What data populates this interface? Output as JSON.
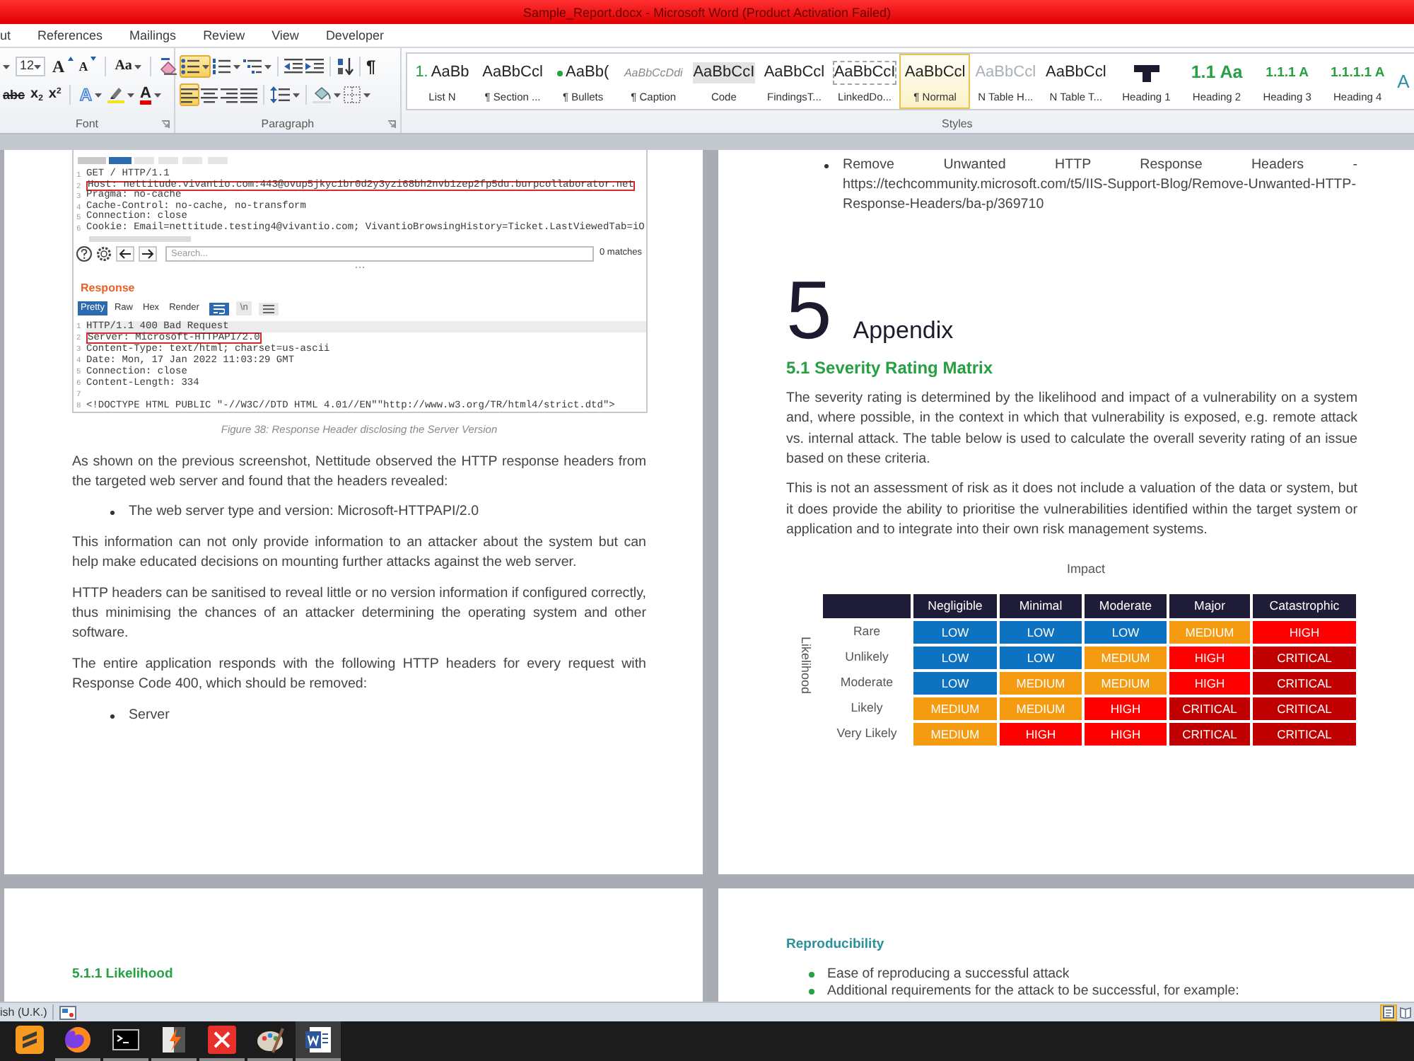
{
  "window": {
    "title": "Sample_Report.docx - Microsoft Word (Product Activation Failed)"
  },
  "ribbon_tabs": [
    {
      "label": "ut",
      "selected": false
    },
    {
      "label": "References",
      "selected": false
    },
    {
      "label": "Mailings",
      "selected": false
    },
    {
      "label": "Review",
      "selected": false
    },
    {
      "label": "View",
      "selected": false
    },
    {
      "label": "Developer",
      "selected": false
    }
  ],
  "font_group": {
    "label": "Font",
    "rows": [
      [
        [
          {
            "kind": "font-name",
            "dropdown": true
          },
          {
            "kind": "size",
            "value": "12",
            "dropdown": true
          },
          {
            "kind": "grow",
            "text": "A",
            "dropdown": false
          },
          {
            "kind": "shrink",
            "text": "A",
            "dropdown": false
          }
        ],
        [
          {
            "kind": "case",
            "text": "Aa",
            "dropdown": true
          }
        ],
        [
          {
            "kind": "clear",
            "dropdown": false
          }
        ]
      ],
      [
        [
          {
            "kind": "strike",
            "text": "abc",
            "dropdown": false
          },
          {
            "kind": "sub",
            "text": "x$_{2}$",
            "dropdown": false
          },
          {
            "kind": "sup",
            "text": "x$^{2}$",
            "dropdown": false
          }
        ],
        [
          {
            "kind": "effects",
            "text": "A",
            "dropdown": true
          },
          {
            "kind": "highlight",
            "dropdown": true
          },
          {
            "kind": "color",
            "text": "A",
            "dropdown": true
          }
        ]
      ]
    ]
  },
  "paragraph_group": {
    "label": "Paragraph",
    "rows": [
      [
        [
          {
            "kind": "bullets",
            "selected": true,
            "dropdown": true
          },
          {
            "kind": "numbering",
            "selected": false,
            "dropdown": true
          },
          {
            "kind": "multilevel",
            "selected": false,
            "dropdown": true
          }
        ],
        [
          {
            "kind": "outdent",
            "selected": false,
            "dropdown": false
          },
          {
            "kind": "indent",
            "selected": false,
            "dropdown": false
          }
        ],
        [
          {
            "kind": "sort",
            "selected": false,
            "dropdown": false
          }
        ],
        [
          {
            "kind": "marks",
            "text": "¶",
            "selected": false,
            "dropdown": false
          }
        ]
      ],
      [
        [
          {
            "kind": "left",
            "selected": true,
            "dropdown": false
          },
          {
            "kind": "center",
            "selected": false,
            "dropdown": false
          },
          {
            "kind": "right",
            "selected": false,
            "dropdown": false
          },
          {
            "kind": "justify",
            "selected": false,
            "dropdown": false
          }
        ],
        [
          {
            "kind": "spacing",
            "selected": false,
            "dropdown": true
          }
        ],
        [
          {
            "kind": "shading",
            "selected": false,
            "dropdown": true
          },
          {
            "kind": "borders",
            "selected": false,
            "dropdown": true
          }
        ]
      ]
    ]
  },
  "styles_group": {
    "label": "Styles",
    "items": [
      {
        "kind": "list",
        "prefix": "1.",
        "preview": "AaBb",
        "label": "List N",
        "selected": false
      },
      {
        "kind": "plain",
        "preview": "AaBbCcl",
        "label": "¶ Section ...",
        "selected": false
      },
      {
        "kind": "bullet",
        "preview": "AaBb(",
        "label": "¶ Bullets",
        "selected": false
      },
      {
        "kind": "caption",
        "preview": "AaBbCcDdi",
        "label": "¶ Caption",
        "selected": false
      },
      {
        "kind": "code",
        "preview": "AaBbCcI",
        "label": "Code",
        "selected": false
      },
      {
        "kind": "plain",
        "preview": "AaBbCcl",
        "label": "FindingsT...",
        "selected": false
      },
      {
        "kind": "linked",
        "preview": "AaBbCcI",
        "label": "LinkedDo...",
        "selected": false
      },
      {
        "kind": "plain",
        "preview": "AaBbCcl",
        "label": "¶ Normal",
        "selected": true
      },
      {
        "kind": "faint",
        "preview": "AaBbCcl",
        "label": "N Table H...",
        "selected": false
      },
      {
        "kind": "plain",
        "preview": "AaBbCcl",
        "label": "N Table T...",
        "selected": false
      },
      {
        "kind": "graphic",
        "label": "Heading 1",
        "selected": false
      },
      {
        "kind": "heading",
        "preview": "1.1 Aa",
        "label": "Heading 2",
        "selected": false
      },
      {
        "kind": "heading-small",
        "preview": "1.1.1 A",
        "label": "Heading 3",
        "selected": false
      },
      {
        "kind": "heading-small",
        "preview": "1.1.1.1 A",
        "label": "Heading 4",
        "selected": false
      },
      {
        "kind": "heading-cut",
        "preview": "A",
        "selected": false
      }
    ]
  },
  "left_page": {
    "screenshot": {
      "request_lines": [
        {
          "number": "1",
          "text": "GET / HTTP/1.1",
          "boxed": false,
          "current": false
        },
        {
          "number": "2",
          "text": "Host: nettitude.vivantio.com:443@ovup5jkyc1br0d2y3yzi68bh2nvb1zep2fp5du.burpcollaborator.net",
          "boxed": true,
          "current": false
        },
        {
          "number": "3",
          "text": "Pragma: no-cache",
          "boxed": false,
          "current": false
        },
        {
          "number": "4",
          "text": "Cache-Control: no-cache, no-transform",
          "boxed": false,
          "current": false
        },
        {
          "number": "5",
          "text": "Connection: close",
          "boxed": false,
          "current": false
        },
        {
          "number": "6",
          "text": "Cookie: Email=nettitude.testing4@vivantio.com; VivantioBrowsingHistory=Ticket.LastViewedTab=iO",
          "boxed": false,
          "current": false
        }
      ],
      "search": {
        "placeholder": "Search...",
        "matches": "0 matches"
      },
      "response_title": "Response",
      "response_tabs": [
        {
          "label": "Pretty",
          "selected": true
        },
        {
          "label": "Raw",
          "selected": false
        },
        {
          "label": "Hex",
          "selected": false
        },
        {
          "label": "Render",
          "selected": false
        }
      ],
      "response_tools": [
        {
          "kind": "wrap",
          "selected": true
        },
        {
          "kind": "newline",
          "text": "\\n",
          "selected": false
        },
        {
          "kind": "menu",
          "selected": false
        }
      ],
      "response_lines": [
        {
          "number": "1",
          "text": "HTTP/1.1 400 Bad Request",
          "boxed": false,
          "current": true
        },
        {
          "number": "2",
          "text": "Server: Microsoft-HTTPAPI/2.0",
          "boxed": true,
          "current": false
        },
        {
          "number": "3",
          "text": "Content-Type: text/html; charset=us-ascii",
          "boxed": false,
          "current": false
        },
        {
          "number": "4",
          "text": "Date: Mon, 17 Jan 2022 11:03:29 GMT",
          "boxed": false,
          "current": false
        },
        {
          "number": "5",
          "text": "Connection: close",
          "boxed": false,
          "current": false
        },
        {
          "number": "6",
          "text": "Content-Length: 334",
          "boxed": false,
          "current": false
        },
        {
          "number": "7",
          "boxed": false,
          "current": false
        },
        {
          "number": "8",
          "text": "<!DOCTYPE HTML PUBLIC \"-//W3C//DTD HTML 4.01//EN\"\"http://www.w3.org/TR/html4/strict.dtd\">",
          "boxed": false,
          "current": false
        }
      ]
    },
    "caption": "Figure 38: Response Header disclosing the Server Version",
    "blocks": [
      {
        "kind": "paragraph",
        "text": "As shown on the previous screenshot, Nettitude observed the HTTP response headers from the targeted web server and found that the headers revealed:"
      },
      {
        "kind": "bullet",
        "text": "The web server type and version: Microsoft-HTTPAPI/2.0"
      },
      {
        "kind": "paragraph",
        "text": "This information can not only provide information to an attacker about the system but can help make educated decisions on mounting further attacks against the web server."
      },
      {
        "kind": "paragraph",
        "text": "HTTP headers can be sanitised to reveal little or no version information if configured correctly, thus minimising the chances of an attacker determining the operating system and other software."
      },
      {
        "kind": "paragraph",
        "text": "The entire application responds with the following HTTP headers for every request with Response Code 400, which should be removed:"
      },
      {
        "kind": "bullet",
        "text": "Server"
      }
    ]
  },
  "right_page": {
    "bullets": [
      "Remove Unwanted HTTP Response Headers - https://techcommunity.microsoft.com/t5/IIS-Support-Blog/Remove-Unwanted-HTTP-Response-Headers/ba-p/369710"
    ],
    "chapter": {
      "number": "5",
      "title": "Appendix"
    },
    "section_title": "5.1 Severity Rating Matrix",
    "paragraphs": [
      "The severity rating is determined by the likelihood and impact of a vulnerability on a system and, where possible, in the context in which that vulnerability is exposed, e.g. remote attack vs. internal attack. The table below is used to calculate the overall severity rating of an issue based on these criteria.",
      "This is not an assessment of risk as it does not include a valuation of the data or system, but it does provide the ability to prioritise the vulnerabilities identified within the target system or application and to integrate into their own risk management systems."
    ],
    "matrix": {
      "x_axis": "Impact",
      "y_axis": "Likelihood",
      "columns": [
        "Negligible",
        "Minimal",
        "Moderate",
        "Major",
        "Catastrophic"
      ],
      "rows": [
        {
          "label": "Rare",
          "cells": [
            {
              "text": "LOW",
              "color": "#0d72c0"
            },
            {
              "text": "LOW",
              "color": "#0d72c0"
            },
            {
              "text": "LOW",
              "color": "#0d72c0"
            },
            {
              "text": "MEDIUM",
              "color": "#f59b12"
            },
            {
              "text": "HIGH",
              "color": "#ff0000"
            }
          ]
        },
        {
          "label": "Unlikely",
          "cells": [
            {
              "text": "LOW",
              "color": "#0d72c0"
            },
            {
              "text": "LOW",
              "color": "#0d72c0"
            },
            {
              "text": "MEDIUM",
              "color": "#f59b12"
            },
            {
              "text": "HIGH",
              "color": "#ff0000"
            },
            {
              "text": "CRITICAL",
              "color": "#c00000"
            }
          ]
        },
        {
          "label": "Moderate",
          "cells": [
            {
              "text": "LOW",
              "color": "#0d72c0"
            },
            {
              "text": "MEDIUM",
              "color": "#f59b12"
            },
            {
              "text": "MEDIUM",
              "color": "#f59b12"
            },
            {
              "text": "HIGH",
              "color": "#ff0000"
            },
            {
              "text": "CRITICAL",
              "color": "#c00000"
            }
          ]
        },
        {
          "label": "Likely",
          "cells": [
            {
              "text": "MEDIUM",
              "color": "#f59b12"
            },
            {
              "text": "MEDIUM",
              "color": "#f59b12"
            },
            {
              "text": "HIGH",
              "color": "#ff0000"
            },
            {
              "text": "CRITICAL",
              "color": "#c00000"
            },
            {
              "text": "CRITICAL",
              "color": "#c00000"
            }
          ]
        },
        {
          "label": "Very Likely",
          "cells": [
            {
              "text": "MEDIUM",
              "color": "#f59b12"
            },
            {
              "text": "HIGH",
              "color": "#ff0000"
            },
            {
              "text": "HIGH",
              "color": "#ff0000"
            },
            {
              "text": "CRITICAL",
              "color": "#c00000"
            },
            {
              "text": "CRITICAL",
              "color": "#c00000"
            }
          ]
        }
      ]
    }
  },
  "next_left_page": {
    "heading": "5.1.1 Likelihood"
  },
  "next_right_page": {
    "heading": "Reproducibility",
    "bullets": [
      "Ease of reproducing a successful attack",
      "Additional requirements for the attack to be successful, for example:"
    ]
  },
  "status_bar": {
    "language": "ish (U.K.)",
    "views": [
      {
        "kind": "print",
        "selected": true
      },
      {
        "kind": "reading",
        "selected": false
      }
    ]
  },
  "taskbar": {
    "apps": [
      {
        "kind": "editor",
        "running": false,
        "active": false
      },
      {
        "kind": "browser",
        "running": true,
        "active": false
      },
      {
        "kind": "terminal",
        "running": true,
        "active": false
      },
      {
        "kind": "proxy",
        "running": true,
        "active": false
      },
      {
        "kind": "mindmap",
        "running": true,
        "active": false
      },
      {
        "kind": "paint",
        "running": true,
        "active": false
      },
      {
        "kind": "writer",
        "running": true,
        "active": true
      }
    ]
  }
}
